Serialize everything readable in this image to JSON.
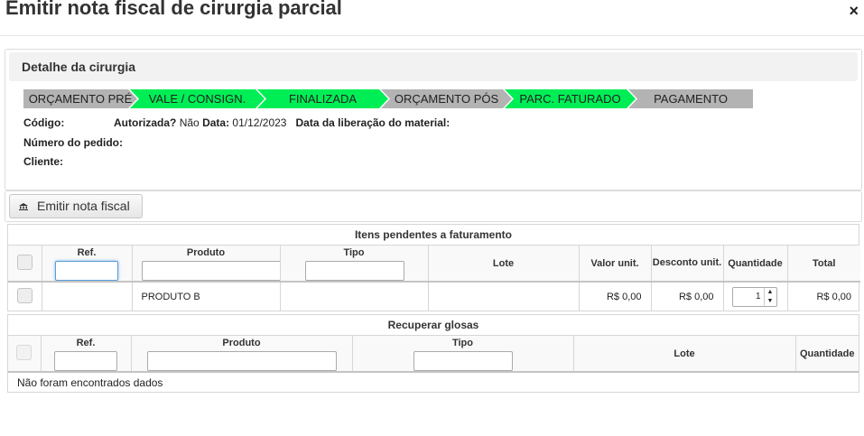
{
  "modal": {
    "title": "Emitir nota fiscal de cirurgia parcial",
    "close": "×"
  },
  "details": {
    "header": "Detalhe da cirurgia",
    "steps": [
      {
        "label": "ORÇAMENTO PRÉ",
        "status": "gray"
      },
      {
        "label": "VALE / CONSIGN.",
        "status": "green"
      },
      {
        "label": "FINALIZADA",
        "status": "green"
      },
      {
        "label": "ORÇAMENTO PÓS",
        "status": "gray"
      },
      {
        "label": "PARC. FATURADO",
        "status": "green"
      },
      {
        "label": "PAGAMENTO",
        "status": "gray"
      }
    ],
    "codigo_label": "Código:",
    "autorizada_label": "Autorizada?",
    "autorizada_value": "Não",
    "data_label": "Data:",
    "data_value": "01/12/2023",
    "liberacao_label": "Data da liberação do material:",
    "pedido_label": "Número do pedido:",
    "cliente_label": "Cliente:"
  },
  "actions": {
    "emit_label": "Emitir nota fiscal",
    "emit_icon": "bank-icon"
  },
  "pending": {
    "title": "Itens pendentes a faturamento",
    "columns": {
      "ref": "Ref.",
      "produto": "Produto",
      "tipo": "Tipo",
      "lote": "Lote",
      "valor": "Valor unit.",
      "desconto": "Desconto unit.",
      "quantidade": "Quantidade",
      "total": "Total"
    },
    "rows": [
      {
        "ref": "",
        "produto": "PRODUTO B",
        "tipo": "",
        "lote": "",
        "valor": "R$ 0,00",
        "desconto": "R$ 0,00",
        "quantidade": "1",
        "total": "R$ 0,00"
      }
    ]
  },
  "glosas": {
    "title": "Recuperar glosas",
    "columns": {
      "ref": "Ref.",
      "produto": "Produto",
      "tipo": "Tipo",
      "lote": "Lote",
      "quantidade": "Quantidade"
    },
    "empty": "Não foram encontrados dados"
  },
  "colors": {
    "step_done": "#00ee55",
    "step_pending": "#b3b3b3",
    "focus": "#5b9dd9"
  }
}
